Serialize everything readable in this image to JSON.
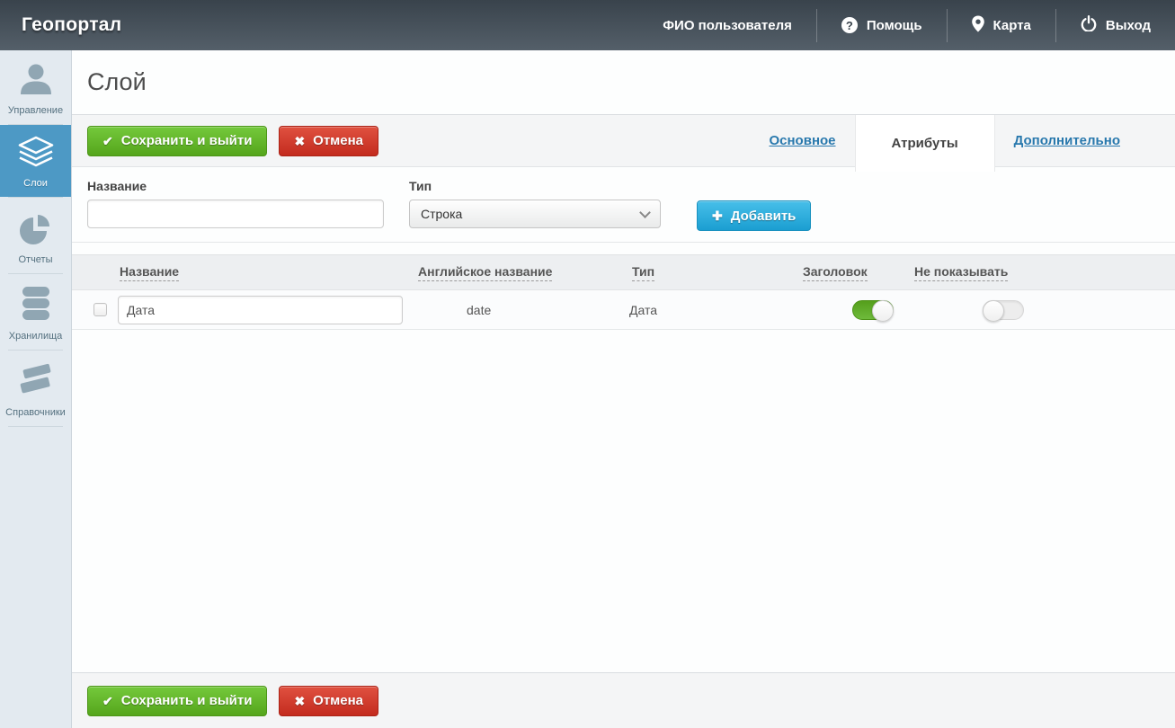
{
  "app": {
    "title": "Геопортал"
  },
  "header": {
    "user_name": "ФИО пользователя",
    "help_label": "Помощь",
    "map_label": "Карта",
    "logout_label": "Выход"
  },
  "sidebar": {
    "items": [
      {
        "label": "Управление",
        "icon": "user-icon",
        "active": false
      },
      {
        "label": "Слои",
        "icon": "layers-icon",
        "active": true
      },
      {
        "label": "Отчеты",
        "icon": "pie-chart-icon",
        "active": false
      },
      {
        "label": "Хранилища",
        "icon": "database-icon",
        "active": false
      },
      {
        "label": "Справочники",
        "icon": "books-icon",
        "active": false
      }
    ]
  },
  "page": {
    "title": "Слой"
  },
  "toolbar": {
    "save_label": "Сохранить и выйти",
    "cancel_label": "Отмена"
  },
  "tabs": {
    "main_label": "Основное",
    "attributes_label": "Атрибуты",
    "additional_label": "Дополнительно",
    "active_tab": "Атрибуты"
  },
  "attribute_form": {
    "name_label": "Название",
    "name_value": "",
    "type_label": "Тип",
    "type_value": "Строка",
    "add_label": "Добавить"
  },
  "attributes_table": {
    "columns": [
      "Название",
      "Английское название",
      "Тип",
      "Заголовок",
      "Не показывать"
    ],
    "rows": [
      {
        "name_value": "Дата",
        "english_name": "date",
        "type": "Дата",
        "header_enabled": true,
        "hide_enabled": false
      }
    ]
  },
  "icons": {
    "check": "✔",
    "cross": "✖",
    "plus": "✚",
    "question": "?"
  },
  "colors": {
    "header_dark": "#39434c",
    "sidebar_bg": "#e3eaf0",
    "sidebar_active_blue": "#4d99c5",
    "save_green": "#5fae24",
    "cancel_red": "#d23a2c",
    "add_blue": "#2aa9da",
    "link_blue": "#2878ad",
    "toggle_on_green": "#61ab2a"
  }
}
